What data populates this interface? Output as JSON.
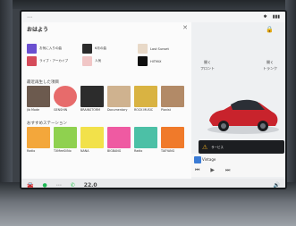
{
  "music": {
    "title": "おはよう",
    "quick": [
      {
        "label": "お気に入りの曲",
        "color": "#6a4fd0"
      },
      {
        "label": "6月の曲",
        "color": "#2b2b2b"
      },
      {
        "label": "Lost Sunset",
        "color": "#e8d9c8"
      },
      {
        "label": "ライブ・アーカイブ",
        "color": "#d54b5a"
      },
      {
        "label": "人気",
        "color": "#f1c6c6"
      },
      {
        "label": "HiTMiX",
        "color": "#101010"
      }
    ],
    "section1": "最近再生した項目",
    "row1": [
      {
        "cap": "Jib Mode",
        "color": "#6c5a4e"
      },
      {
        "cap": "GENSHIN",
        "color": "#e76b6b",
        "round": true
      },
      {
        "cap": "BRAINSTORM",
        "color": "#2c2c2c"
      },
      {
        "cap": "Documentary",
        "color": "#cfb28f"
      },
      {
        "cap": "ROCK MUSIC",
        "color": "#d9b342"
      },
      {
        "cap": "Pianist",
        "color": "#b28a67"
      },
      {
        "cap": "Pops",
        "color": "#d8cfc9",
        "round": true
      }
    ],
    "section2": "おすすめステーション",
    "row2": [
      {
        "cap": "Radio",
        "color": "#f3a73b"
      },
      {
        "cap": "TXMeeSiiNo",
        "color": "#8fd14f"
      },
      {
        "cap": "NANA",
        "color": "#f2e14a"
      },
      {
        "cap": "BIGBANG",
        "color": "#ef5aa2"
      },
      {
        "cap": "Radio",
        "color": "#4cc0a6"
      },
      {
        "cap": "TAEYANG",
        "color": "#f07a2a"
      }
    ]
  },
  "car": {
    "frunk_label": "フロント",
    "frunk_state": "開く",
    "trunk_label": "トランク",
    "trunk_state": "開く",
    "body_color": "#c8232c",
    "alert_text": "サービス",
    "alert_icon": "warning-icon"
  },
  "nowplaying": {
    "title": "Vintage"
  },
  "bottom": {
    "temp": "22.0"
  }
}
